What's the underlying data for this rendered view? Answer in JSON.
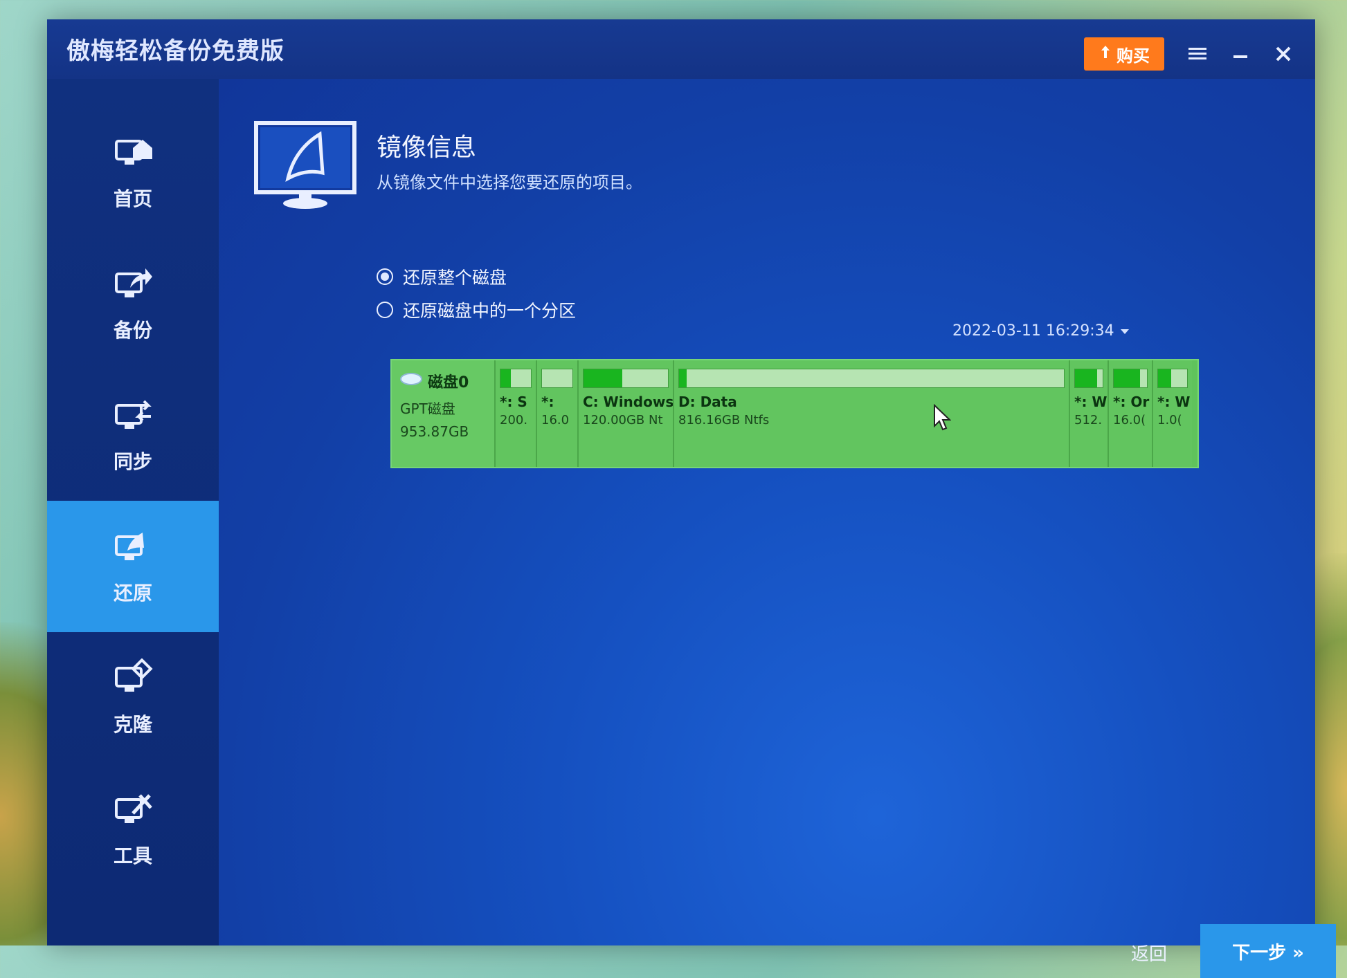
{
  "app": {
    "title": "傲梅轻松备份免费版",
    "buy_label": "购买",
    "accent_orange": "#ff7a1c",
    "accent_blue": "#2a97ea"
  },
  "window_controls": {
    "menu_icon": "menu-icon",
    "minimize_icon": "minimize-icon",
    "close_icon": "close-icon"
  },
  "sidebar": {
    "items": [
      {
        "label": "首页",
        "icon": "home-icon",
        "active": false
      },
      {
        "label": "备份",
        "icon": "backup-icon",
        "active": false
      },
      {
        "label": "同步",
        "icon": "sync-icon",
        "active": false
      },
      {
        "label": "还原",
        "icon": "restore-icon",
        "active": true
      },
      {
        "label": "克隆",
        "icon": "clone-icon",
        "active": false
      },
      {
        "label": "工具",
        "icon": "tools-icon",
        "active": false
      }
    ]
  },
  "header": {
    "title": "镜像信息",
    "subtitle": "从镜像文件中选择您要还原的项目。"
  },
  "options": {
    "restore_disk": "还原整个磁盘",
    "restore_partition": "还原磁盘中的一个分区",
    "selected": "restore_disk"
  },
  "backup_time": "2022-03-11 16:29:34",
  "disk": {
    "name": "磁盘0",
    "type": "GPT磁盘",
    "size": "953.87GB",
    "partitions": [
      {
        "label": "*: S",
        "size": "200.",
        "used_fraction": 0.35
      },
      {
        "label": "*:",
        "size": "16.0",
        "used_fraction": 0.0
      },
      {
        "label": "C: Windows",
        "size": "120.00GB Nt",
        "used_fraction": 0.46
      },
      {
        "label": "D: Data",
        "size": "816.16GB Ntfs",
        "used_fraction": 0.02
      },
      {
        "label": "*: W",
        "size": "512.",
        "used_fraction": 0.8
      },
      {
        "label": "*: Or",
        "size": "16.0(",
        "used_fraction": 0.8
      },
      {
        "label": "*: W",
        "size": "1.0(",
        "used_fraction": 0.45
      }
    ]
  },
  "footer": {
    "back_label": "返回",
    "next_label": "下一步 »"
  }
}
